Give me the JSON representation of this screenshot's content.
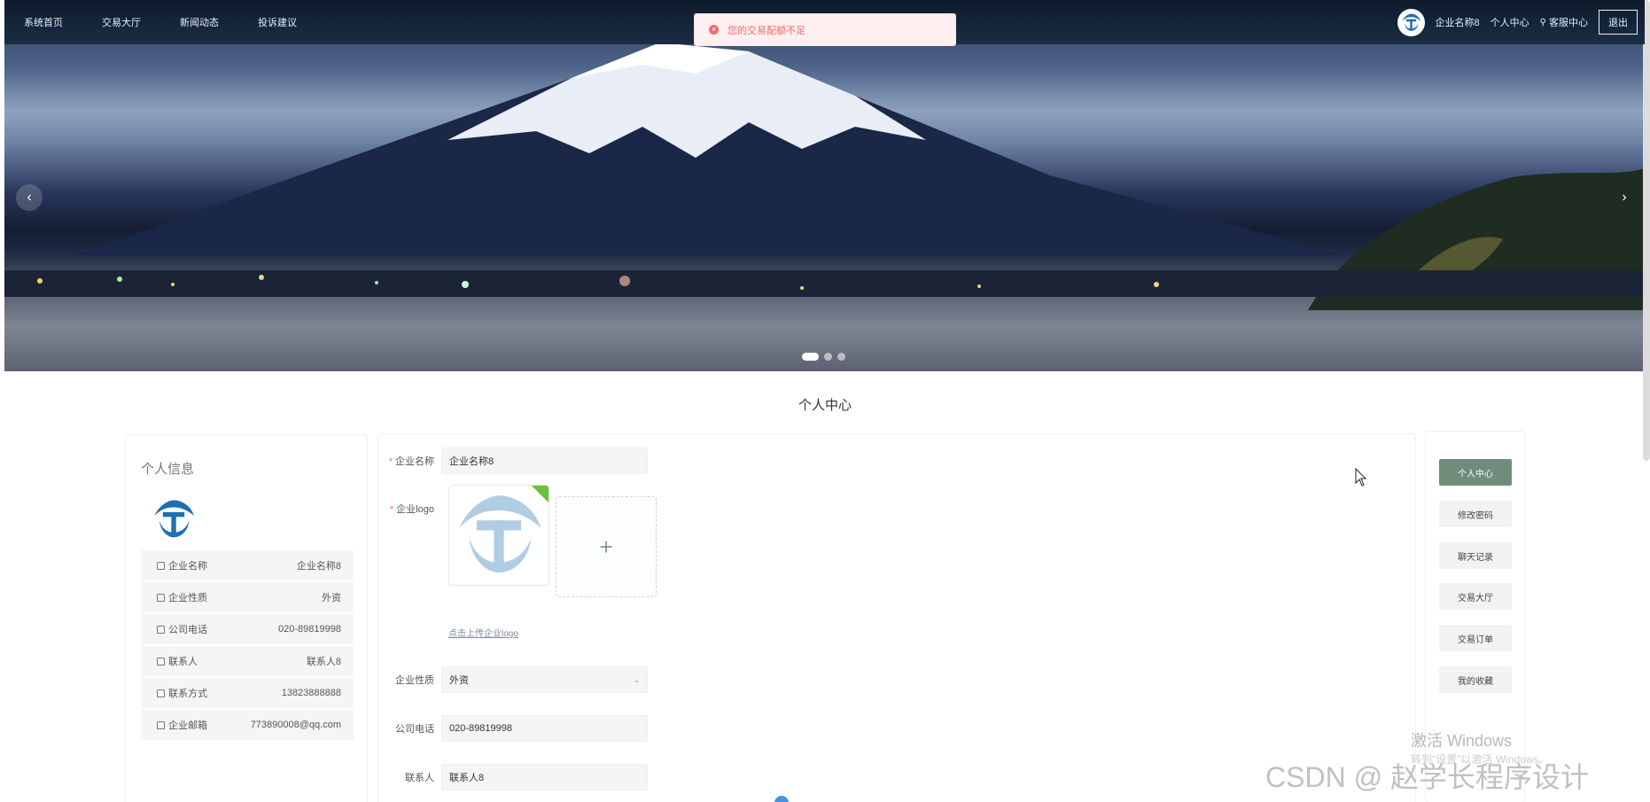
{
  "nav": {
    "links": [
      "系统首页",
      "交易大厅",
      "新闻动态",
      "投诉建议"
    ],
    "company_name": "企业名称8",
    "personal_center": "个人中心",
    "service_center": "客服中心",
    "logout": "退出"
  },
  "toast": {
    "message": "您的交易配额不足",
    "type": "error",
    "color": "#f56c6c"
  },
  "banner": {
    "active_slide": 1,
    "slide_count": 3
  },
  "section_title": "个人中心",
  "profile": {
    "title": "个人信息",
    "rows": [
      {
        "label": "企业名称",
        "value": "企业名称8"
      },
      {
        "label": "企业性质",
        "value": "外资"
      },
      {
        "label": "公司电话",
        "value": "020-89819998"
      },
      {
        "label": "联系人",
        "value": "联系人8"
      },
      {
        "label": "联系方式",
        "value": "13823888888"
      },
      {
        "label": "企业邮箱",
        "value": "773890008@qq.com"
      }
    ]
  },
  "form": {
    "company_name_label": "企业名称",
    "company_name_value": "企业名称8",
    "logo_label": "企业logo",
    "upload_tip": "点击上传企业logo",
    "nature_label": "企业性质",
    "nature_value": "外资",
    "phone_label": "公司电话",
    "phone_value": "020-89819998",
    "contact_label": "联系人",
    "contact_value": "联系人8"
  },
  "menu": {
    "items": [
      "个人中心",
      "修改密码",
      "聊天记录",
      "交易大厅",
      "交易订单",
      "我的收藏"
    ],
    "active_index": 0,
    "active_color": "#708d7c"
  },
  "watermarks": {
    "windows_title": "激活 Windows",
    "windows_sub": "转到\"设置\"以激活 Windows。",
    "csdn": "CSDN @ 赵学长程序设计"
  }
}
